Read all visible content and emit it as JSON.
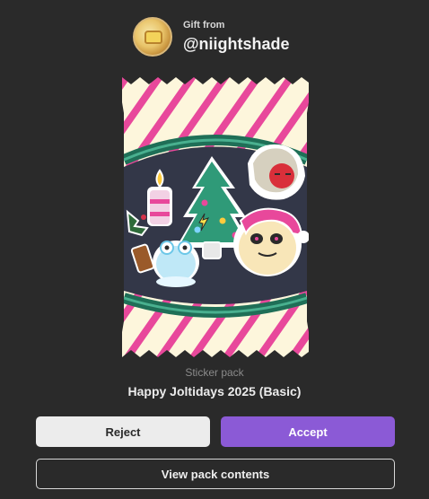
{
  "gift": {
    "from_label": "Gift from",
    "username": "@niightshade"
  },
  "pack": {
    "type_label": "Sticker pack",
    "name": "Happy Joltidays 2025 (Basic)"
  },
  "actions": {
    "reject_label": "Reject",
    "accept_label": "Accept",
    "view_contents_label": "View pack contents"
  },
  "colors": {
    "background": "#2a2a2a",
    "accent": "#8b5ad6",
    "stripe_pink": "#e8489b",
    "stripe_cream": "#fdf6dc",
    "band_green": "#2e8b6f"
  },
  "icons": {
    "avatar": "toast-avatar",
    "stickers": [
      "candle-sticker",
      "christmas-tree-sticker",
      "santa-hat-sticker",
      "panda-santa-sticker",
      "frog-sticker",
      "holly-sticker"
    ]
  }
}
